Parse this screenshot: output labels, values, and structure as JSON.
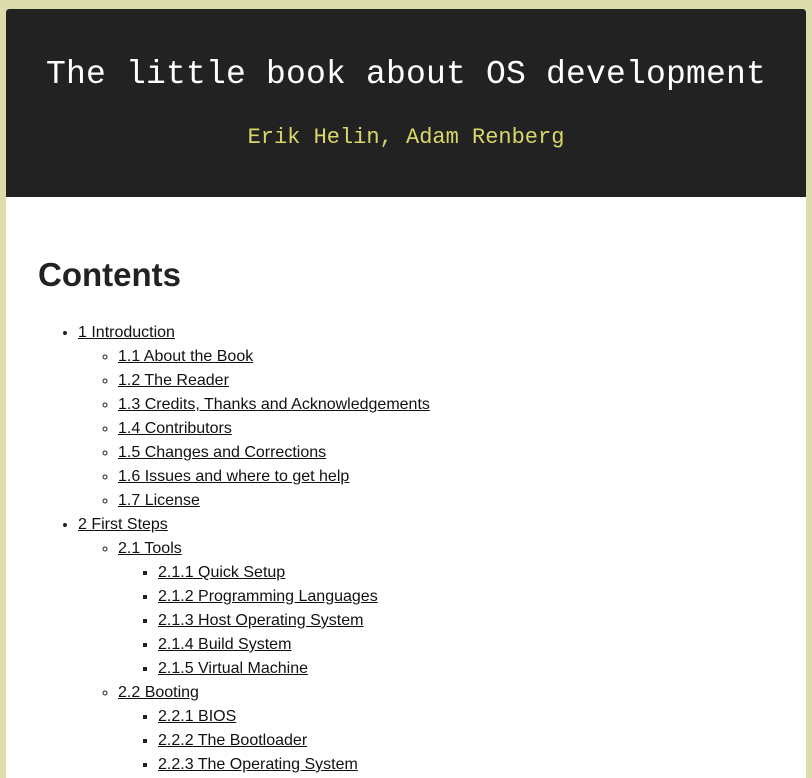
{
  "header": {
    "title": "The little book about OS development",
    "authors": "Erik Helin, Adam Renberg"
  },
  "contents": {
    "heading": "Contents",
    "chapters": [
      {
        "label": "1 Introduction",
        "sections": [
          {
            "label": "1.1 About the Book"
          },
          {
            "label": "1.2 The Reader"
          },
          {
            "label": "1.3 Credits, Thanks and Acknowledgements"
          },
          {
            "label": "1.4 Contributors"
          },
          {
            "label": "1.5 Changes and Corrections"
          },
          {
            "label": "1.6 Issues and where to get help"
          },
          {
            "label": "1.7 License"
          }
        ]
      },
      {
        "label": "2 First Steps",
        "sections": [
          {
            "label": "2.1 Tools",
            "subsections": [
              {
                "label": "2.1.1 Quick Setup"
              },
              {
                "label": "2.1.2 Programming Languages"
              },
              {
                "label": "2.1.3 Host Operating System"
              },
              {
                "label": "2.1.4 Build System"
              },
              {
                "label": "2.1.5 Virtual Machine"
              }
            ]
          },
          {
            "label": "2.2 Booting",
            "subsections": [
              {
                "label": "2.2.1 BIOS"
              },
              {
                "label": "2.2.2 The Bootloader"
              },
              {
                "label": "2.2.3 The Operating System"
              }
            ]
          }
        ]
      }
    ]
  }
}
